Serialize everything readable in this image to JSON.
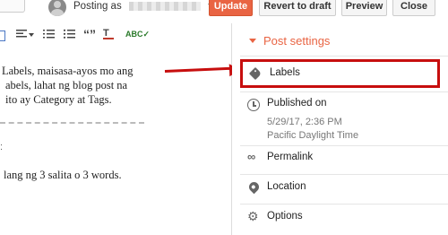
{
  "header": {
    "posting_as": "Posting as",
    "buttons": {
      "update": "Update",
      "revert": "Revert to draft",
      "preview": "Preview",
      "close": "Close"
    },
    "accent_color": "#e96443"
  },
  "editor": {
    "toolbar": {
      "quote_glyph": "“”",
      "clear_glyph": "T",
      "spell_glyph": "ABC✓"
    },
    "lines": [
      "Labels, maisasa-ayos mo ang",
      "abels, lahat ng blog post na",
      "ito ay Category at Tags.",
      "lang ng 3 salita o 3 words."
    ]
  },
  "sidebar": {
    "section_title": "Post settings",
    "items": {
      "labels": "Labels",
      "published_on": "Published on",
      "published_date": "5/29/17, 2:36 PM",
      "published_tz": "Pacific Daylight Time",
      "permalink": "Permalink",
      "location": "Location",
      "options": "Options"
    },
    "highlight_color": "#c70e0e"
  }
}
